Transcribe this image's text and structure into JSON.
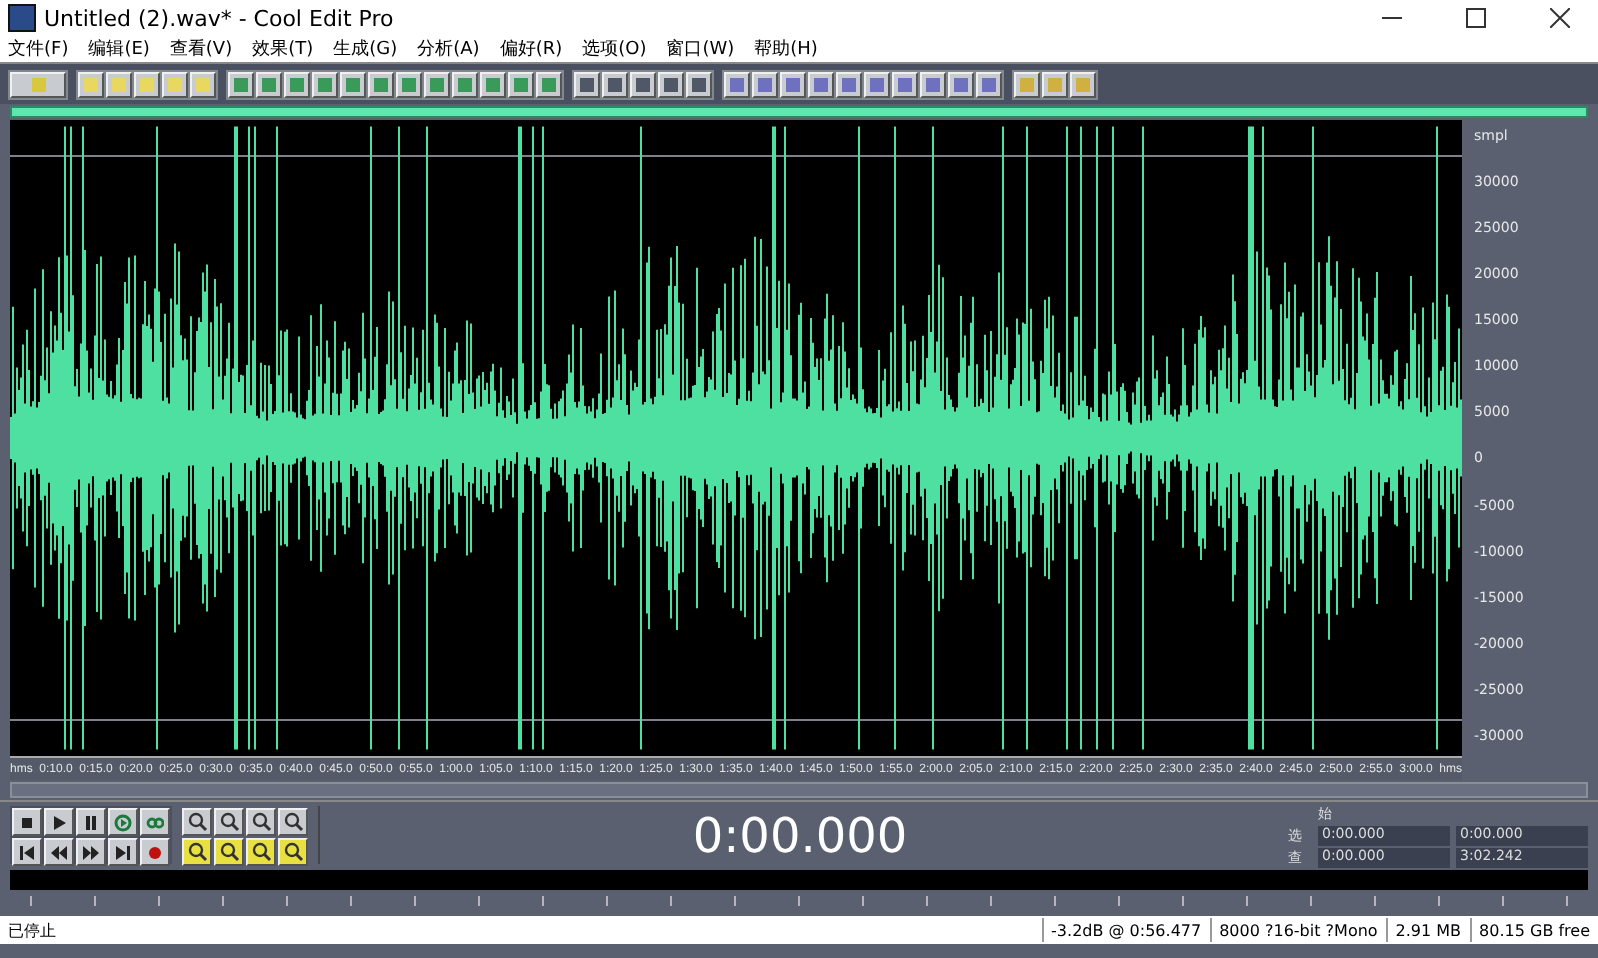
{
  "window": {
    "title": "Untitled (2).wav* - Cool Edit Pro"
  },
  "menu": [
    "文件(F)",
    "编辑(E)",
    "查看(V)",
    "效果(T)",
    "生成(G)",
    "分析(A)",
    "偏好(R)",
    "选项(O)",
    "窗口(W)",
    "帮助(H)"
  ],
  "waveform": {
    "y_unit": "smpl",
    "y_labels": [
      "30000",
      "25000",
      "20000",
      "15000",
      "10000",
      "5000",
      "0",
      "-5000",
      "-10000",
      "-15000",
      "-20000",
      "-25000",
      "-30000"
    ],
    "time_unit_left": "hms",
    "time_unit_right": "hms",
    "time_labels": [
      "0:10.0",
      "0:15.0",
      "0:20.0",
      "0:25.0",
      "0:30.0",
      "0:35.0",
      "0:40.0",
      "0:45.0",
      "0:50.0",
      "0:55.0",
      "1:00.0",
      "1:05.0",
      "1:10.0",
      "1:15.0",
      "1:20.0",
      "1:25.0",
      "1:30.0",
      "1:35.0",
      "1:40.0",
      "1:45.0",
      "1:50.0",
      "1:55.0",
      "2:00.0",
      "2:05.0",
      "2:10.0",
      "2:15.0",
      "2:20.0",
      "2:25.0",
      "2:30.0",
      "2:35.0",
      "2:40.0",
      "2:45.0",
      "2:50.0",
      "2:55.0",
      "3:00.0"
    ]
  },
  "transport": {
    "time": "0:00.000"
  },
  "selection": {
    "header": "始",
    "rows": [
      {
        "label": "选",
        "start": "0:00.000",
        "end": "0:00.000"
      },
      {
        "label": "查",
        "start": "0:00.000",
        "end": "3:02.242"
      }
    ]
  },
  "status_bar": [
    "已停止",
    "-3.2dB @  0:56.477",
    "8000 ?16-bit ?Mono",
    "2.91 MB",
    "80.15 GB free"
  ]
}
